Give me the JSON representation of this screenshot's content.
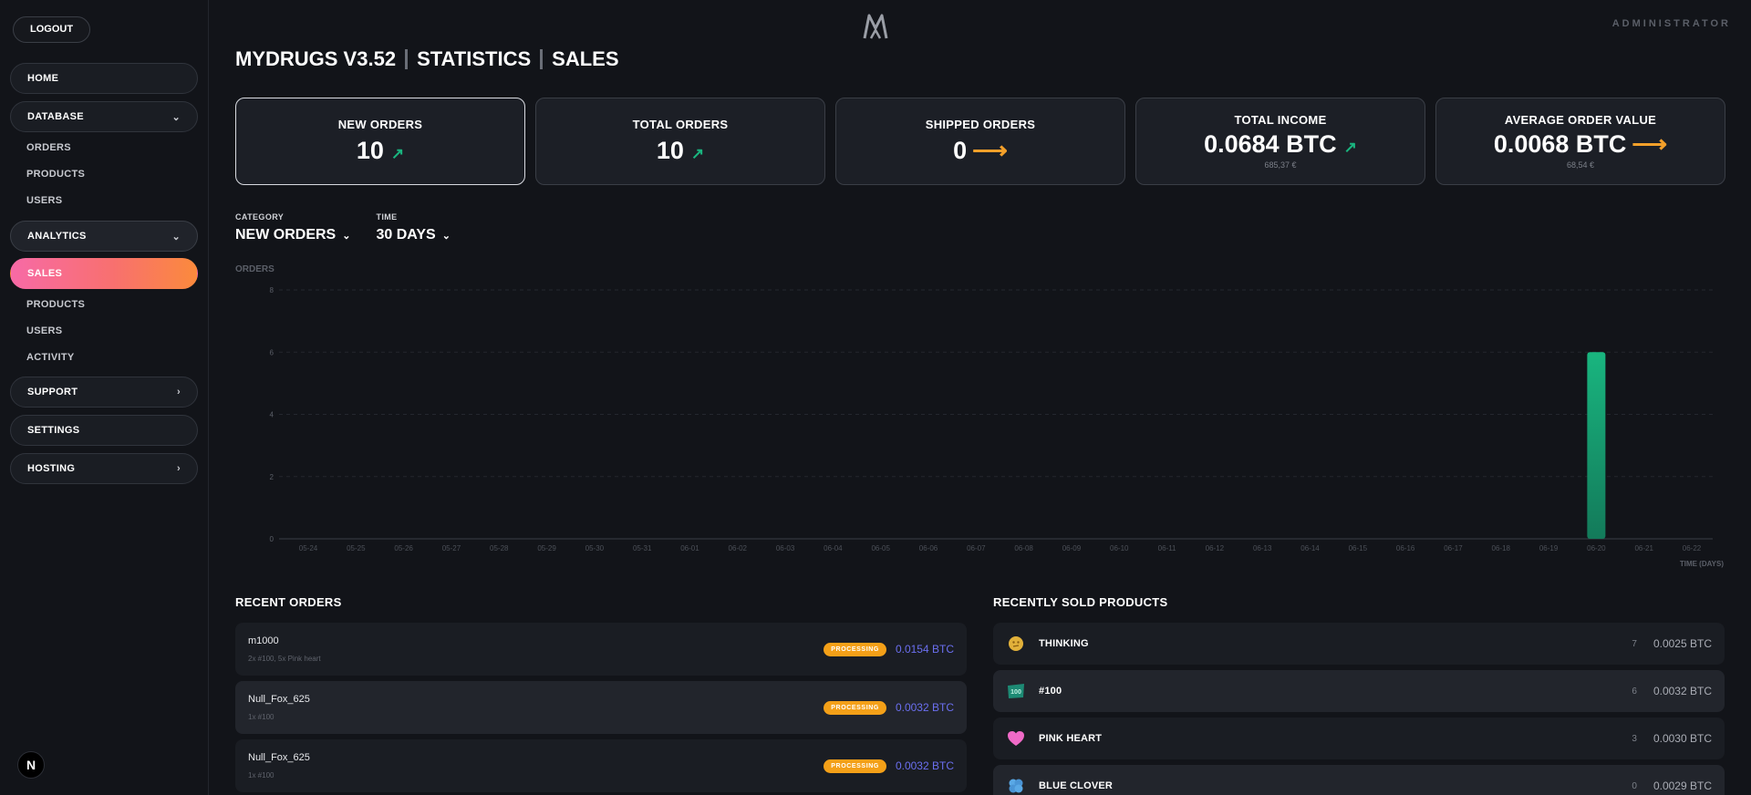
{
  "header": {
    "admin_label": "ADMINISTRATOR",
    "title_parts": [
      "MYDRUGS V3.52",
      "STATISTICS",
      "SALES"
    ]
  },
  "sidebar": {
    "logout": "LOGOUT",
    "home": "HOME",
    "database": {
      "label": "DATABASE",
      "items": [
        "ORDERS",
        "PRODUCTS",
        "USERS"
      ]
    },
    "analytics": {
      "label": "ANALYTICS",
      "active": "SALES",
      "items": [
        "PRODUCTS",
        "USERS",
        "ACTIVITY"
      ]
    },
    "support": "SUPPORT",
    "settings": "SETTINGS",
    "hosting": "HOSTING",
    "badge": "N"
  },
  "cards": [
    {
      "label": "NEW ORDERS",
      "value": "10",
      "trend": "up",
      "sub": ""
    },
    {
      "label": "TOTAL ORDERS",
      "value": "10",
      "trend": "up",
      "sub": ""
    },
    {
      "label": "SHIPPED ORDERS",
      "value": "0",
      "trend": "flat",
      "sub": ""
    },
    {
      "label": "TOTAL INCOME",
      "value": "0.0684 BTC",
      "trend": "up",
      "sub": "685,37 €"
    },
    {
      "label": "AVERAGE ORDER VALUE",
      "value": "0.0068 BTC",
      "trend": "flat",
      "sub": "68,54 €"
    }
  ],
  "filters": {
    "category_label": "CATEGORY",
    "category_value": "NEW ORDERS",
    "time_label": "TIME",
    "time_value": "30 DAYS"
  },
  "chart_data": {
    "type": "bar",
    "ylabel": "ORDERS",
    "xlabel": "TIME (DAYS)",
    "ylim": [
      0,
      8
    ],
    "yticks": [
      0,
      2,
      4,
      6,
      8
    ],
    "categories": [
      "05-24",
      "05-25",
      "05-26",
      "05-27",
      "05-28",
      "05-29",
      "05-30",
      "05-31",
      "06-01",
      "06-02",
      "06-03",
      "06-04",
      "06-05",
      "06-06",
      "06-07",
      "06-08",
      "06-09",
      "06-10",
      "06-11",
      "06-12",
      "06-13",
      "06-14",
      "06-15",
      "06-16",
      "06-17",
      "06-18",
      "06-19",
      "06-20",
      "06-21",
      "06-22"
    ],
    "values": [
      0,
      0,
      0,
      0,
      0,
      0,
      0,
      0,
      0,
      0,
      0,
      0,
      0,
      0,
      0,
      0,
      0,
      0,
      0,
      0,
      0,
      0,
      0,
      0,
      0,
      0,
      0,
      6,
      0,
      0
    ],
    "bar_color": "#19b57f",
    "grid": true
  },
  "recent_orders": {
    "title": "RECENT ORDERS",
    "rows": [
      {
        "name": "m1000",
        "desc": "2x #100, 5x Pink heart",
        "status": "PROCESSING",
        "price": "0.0154 BTC"
      },
      {
        "name": "Null_Fox_625",
        "desc": "1x #100",
        "status": "PROCESSING",
        "price": "0.0032 BTC"
      },
      {
        "name": "Null_Fox_625",
        "desc": "1x #100",
        "status": "PROCESSING",
        "price": "0.0032 BTC"
      }
    ]
  },
  "recent_products": {
    "title": "RECENTLY SOLD PRODUCTS",
    "rows": [
      {
        "name": "THINKING",
        "qty": "7",
        "price": "0.0025 BTC",
        "icon": "thinking-pill-icon"
      },
      {
        "name": "#100",
        "qty": "6",
        "price": "0.0032 BTC",
        "icon": "hundred-pill-icon"
      },
      {
        "name": "PINK HEART",
        "qty": "3",
        "price": "0.0030 BTC",
        "icon": "pink-heart-icon"
      },
      {
        "name": "BLUE CLOVER",
        "qty": "0",
        "price": "0.0029 BTC",
        "icon": "blue-clover-icon"
      }
    ]
  },
  "colors": {
    "accent_gradient": [
      "#f76aa6",
      "#fb8a3c"
    ],
    "up_arrow": "#19b57f",
    "flat_arrow": "#f4a02a",
    "processing": "#f4a018",
    "btc_price": "#6b6ff0"
  }
}
